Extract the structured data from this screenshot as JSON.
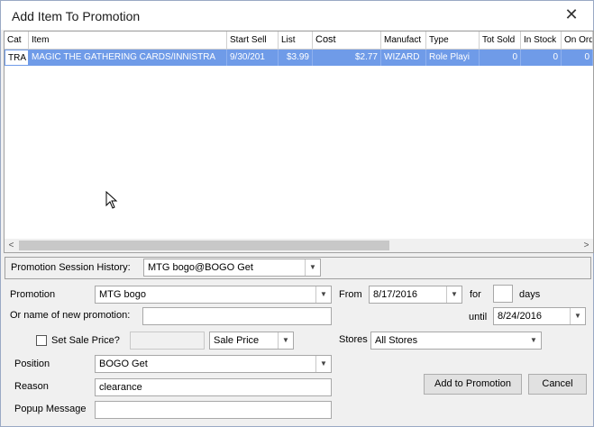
{
  "window": {
    "title": "Add Item To Promotion",
    "close_glyph": "✕"
  },
  "grid": {
    "columns": [
      "Cat",
      "Item",
      "Start Sell",
      "List",
      "Cost",
      "Manufact",
      "Type",
      "Tot Sold",
      "In Stock",
      "On Ord"
    ],
    "rows": [
      [
        "TRA",
        "MAGIC THE GATHERING CARDS/INNISTRA",
        "9/30/201",
        "$3.99",
        "$2.77",
        "WIZARD",
        "Role Playi",
        "0",
        "0",
        "0"
      ]
    ]
  },
  "session": {
    "label": "Promotion Session History:",
    "value": "MTG bogo@BOGO Get"
  },
  "promotion": {
    "label": "Promotion",
    "value": "MTG bogo"
  },
  "new_promotion": {
    "label": "Or name of new promotion:",
    "value": ""
  },
  "sale_price": {
    "checkbox_label": "Set Sale Price?",
    "value": "",
    "type": "Sale Price"
  },
  "position": {
    "label": "Position",
    "value": "BOGO Get"
  },
  "reason": {
    "label": "Reason",
    "value": "clearance"
  },
  "popup": {
    "label": "Popup Message",
    "value": ""
  },
  "dates": {
    "from_label": "From",
    "from": "8/17/2016",
    "for_label": "for",
    "days": "",
    "days_label": "days",
    "until_label": "until",
    "until": "8/24/2016"
  },
  "stores": {
    "label": "Stores",
    "value": "All Stores"
  },
  "buttons": {
    "add": "Add to Promotion",
    "cancel": "Cancel"
  },
  "icons": {
    "dropdown": "▼",
    "scroll_left": "<",
    "scroll_right": ">"
  }
}
